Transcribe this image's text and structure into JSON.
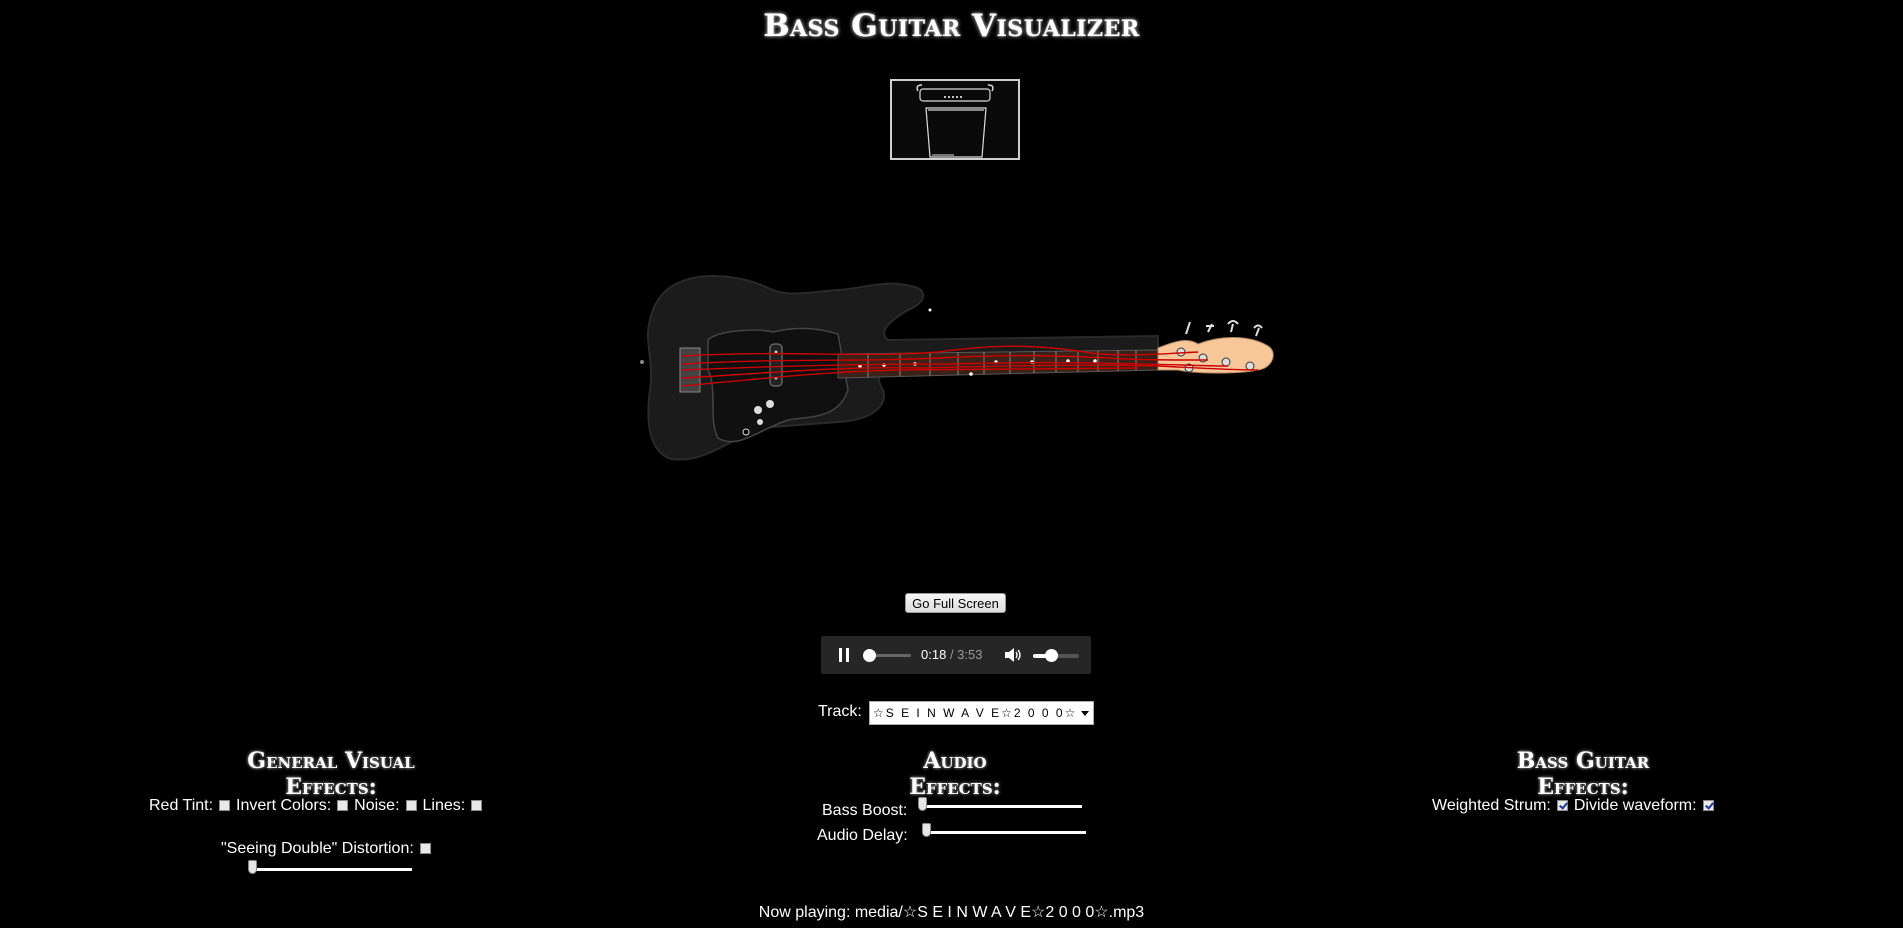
{
  "title": "Bass Guitar Visualizer",
  "fullscreen_button": "Go Full Screen",
  "player": {
    "current_time": "0:18",
    "duration": "/ 3:53",
    "progress_fraction": 0.077,
    "volume_fraction": 0.4
  },
  "track": {
    "label": "Track:",
    "selected": "☆S E I N W A V E☆2 0 0 0☆"
  },
  "visual_effects": {
    "heading": "General Visual Effects:",
    "red_tint": "Red Tint:",
    "invert_colors": "Invert Colors:",
    "noise": "Noise:",
    "lines": "Lines:",
    "seeing_double": "\"Seeing Double\" Distortion:",
    "distortion_level": 0.0
  },
  "audio_effects": {
    "heading": "Audio Effects:",
    "bass_boost": "Bass Boost:",
    "audio_delay": "Audio Delay:",
    "bass_boost_level": 0.0,
    "audio_delay_level": 0.0
  },
  "bass_effects": {
    "heading": "Bass Guitar Effects:",
    "weighted_strum": "Weighted Strum:",
    "divide_waveform": "Divide waveform:",
    "weighted_strum_checked": true,
    "divide_waveform_checked": true
  },
  "now_playing": "Now playing: media/☆S E I N W A V E☆2 0 0 0☆.mp3",
  "colors": {
    "background": "#000000",
    "string_red": "#cc0000",
    "headstock": "#f7c79a",
    "fretboard": "#3a2218"
  }
}
